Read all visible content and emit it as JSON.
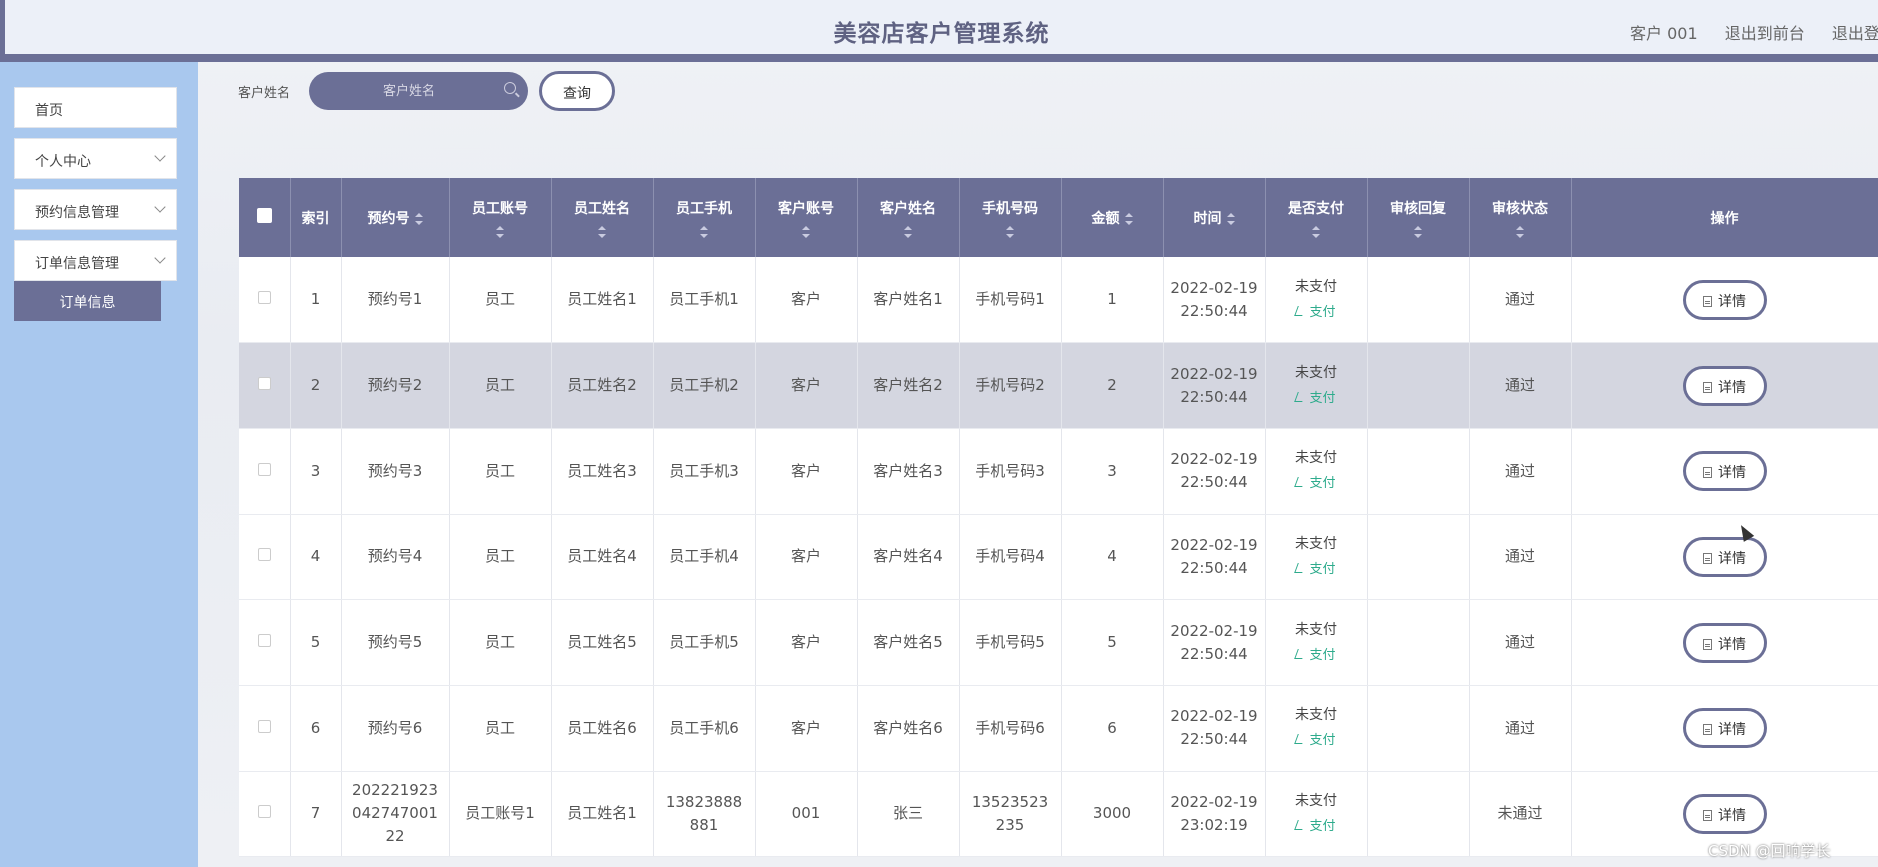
{
  "header": {
    "title": "美容店客户管理系统",
    "user": "客户 001",
    "back_front": "退出到前台",
    "logout": "退出登录"
  },
  "sidebar": {
    "items": [
      {
        "label": "首页"
      },
      {
        "label": "个人中心"
      },
      {
        "label": "预约信息管理"
      },
      {
        "label": "订单信息管理"
      }
    ],
    "active_sub": "订单信息"
  },
  "search": {
    "label": "客户姓名",
    "placeholder": "客户姓名",
    "button": "查询"
  },
  "table": {
    "columns": [
      "索引",
      "预约号",
      "员工账号",
      "员工姓名",
      "员工手机",
      "客户账号",
      "客户姓名",
      "手机号码",
      "金额",
      "时间",
      "是否支付",
      "审核回复",
      "审核状态",
      "操作"
    ],
    "pay_action": "支付",
    "detail_label": "详情",
    "rows": [
      {
        "idx": "1",
        "booking": "预约号1",
        "emp_acc": "员工",
        "emp_name": "员工姓名1",
        "emp_phone": "员工手机1",
        "cust_acc": "客户",
        "cust_name": "客户姓名1",
        "phone": "手机号码1",
        "amount": "1",
        "time_date": "2022-02-19",
        "time_clock": "22:50:44",
        "paid": "未支付",
        "reply": "",
        "status": "通过"
      },
      {
        "idx": "2",
        "booking": "预约号2",
        "emp_acc": "员工",
        "emp_name": "员工姓名2",
        "emp_phone": "员工手机2",
        "cust_acc": "客户",
        "cust_name": "客户姓名2",
        "phone": "手机号码2",
        "amount": "2",
        "time_date": "2022-02-19",
        "time_clock": "22:50:44",
        "paid": "未支付",
        "reply": "",
        "status": "通过"
      },
      {
        "idx": "3",
        "booking": "预约号3",
        "emp_acc": "员工",
        "emp_name": "员工姓名3",
        "emp_phone": "员工手机3",
        "cust_acc": "客户",
        "cust_name": "客户姓名3",
        "phone": "手机号码3",
        "amount": "3",
        "time_date": "2022-02-19",
        "time_clock": "22:50:44",
        "paid": "未支付",
        "reply": "",
        "status": "通过"
      },
      {
        "idx": "4",
        "booking": "预约号4",
        "emp_acc": "员工",
        "emp_name": "员工姓名4",
        "emp_phone": "员工手机4",
        "cust_acc": "客户",
        "cust_name": "客户姓名4",
        "phone": "手机号码4",
        "amount": "4",
        "time_date": "2022-02-19",
        "time_clock": "22:50:44",
        "paid": "未支付",
        "reply": "",
        "status": "通过"
      },
      {
        "idx": "5",
        "booking": "预约号5",
        "emp_acc": "员工",
        "emp_name": "员工姓名5",
        "emp_phone": "员工手机5",
        "cust_acc": "客户",
        "cust_name": "客户姓名5",
        "phone": "手机号码5",
        "amount": "5",
        "time_date": "2022-02-19",
        "time_clock": "22:50:44",
        "paid": "未支付",
        "reply": "",
        "status": "通过"
      },
      {
        "idx": "6",
        "booking": "预约号6",
        "emp_acc": "员工",
        "emp_name": "员工姓名6",
        "emp_phone": "员工手机6",
        "cust_acc": "客户",
        "cust_name": "客户姓名6",
        "phone": "手机号码6",
        "amount": "6",
        "time_date": "2022-02-19",
        "time_clock": "22:50:44",
        "paid": "未支付",
        "reply": "",
        "status": "通过"
      },
      {
        "idx": "7",
        "booking": "20222192304274700122",
        "emp_acc": "员工账号1",
        "emp_name": "员工姓名1",
        "emp_phone": "13823888881",
        "cust_acc": "001",
        "cust_name": "张三",
        "phone": "13523523235",
        "amount": "3000",
        "time_date": "2022-02-19",
        "time_clock": "23:02:19",
        "paid": "未支付",
        "reply": "",
        "status": "未通过"
      }
    ]
  },
  "watermark": "CSDN @回响学长"
}
